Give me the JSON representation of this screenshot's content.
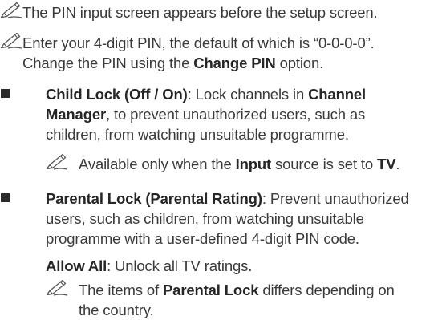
{
  "notes": [
    {
      "icon": "note-pencil-icon",
      "text": "The PIN input screen appears before the setup screen."
    },
    {
      "icon": "note-pencil-icon",
      "line1": "Enter your 4-digit PIN, the default of which is “0-0-0-0”.",
      "line2_pre": "Change the PIN using the ",
      "line2_bold": "Change PIN",
      "line2_post": " option."
    }
  ],
  "child_lock": {
    "title": "Child Lock (Off / On)",
    "desc_pre": ": Lock channels in ",
    "desc_bold": "Channel",
    "desc_line2_bold": "Manager",
    "desc_line2_post": ", to prevent unauthorized users, such as",
    "desc_line3": "children, from watching unsuitable programme.",
    "note_pre": "Available only when the ",
    "note_input": "Input",
    "note_mid": " source is set to ",
    "note_tv": "TV",
    "note_end": "."
  },
  "parental_lock": {
    "title": "Parental Lock (Parental Rating)",
    "desc_line1": ": Prevent unauthorized",
    "desc_line2": "users, such as children, from watching unsuitable",
    "desc_line3": "programme with a user-defined 4-digit PIN code.",
    "allow_all_bold": "Allow All",
    "allow_all_text": ": Unlock all TV ratings.",
    "note_pre": "The items of ",
    "note_bold": "Parental Lock",
    "note_post": " differs depending on",
    "note_line2": "the country."
  }
}
